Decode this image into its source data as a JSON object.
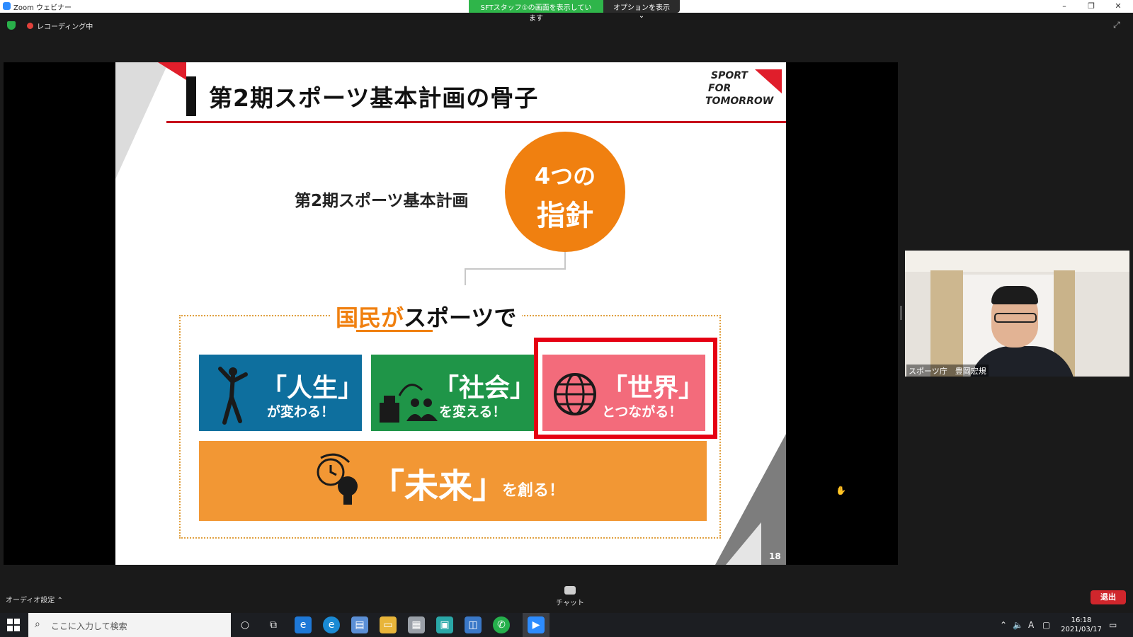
{
  "window": {
    "title": "Zoom ウェビナー",
    "share_banner": "SFTスタッフ①の画面を表示しています",
    "options_label": "オプションを表示 ⌄",
    "minimize": "–",
    "restore": "❐",
    "close": "✕"
  },
  "recording": {
    "label": "レコーディング中"
  },
  "slide": {
    "title": "第2期スポーツ基本計画の骨子",
    "logo_lines": [
      "SPORT",
      "FOR",
      "TOMORROW"
    ],
    "plan_label": "第2期スポーツ基本計画",
    "circle_line1": "4つの",
    "circle_line2": "指針",
    "nation_orange": "国民が",
    "nation_rest": "スポーツで",
    "cards": [
      {
        "big": "「人生」",
        "small": "が変わる！"
      },
      {
        "big": "「社会」",
        "small": "を変える！"
      },
      {
        "big": "「世界」",
        "small": "とつながる！"
      }
    ],
    "future_big": "「未来」",
    "future_small": "を創る！",
    "page_number": "18"
  },
  "participant": {
    "name": "スポーツ庁　豊岡宏規"
  },
  "toolbar": {
    "audio_label": "オーディオ設定 ⌃",
    "chat_label": "チャット",
    "leave_label": "退出"
  },
  "taskbar": {
    "search_placeholder": "ここに入力して検索",
    "time": "16:18",
    "date": "2021/03/17"
  },
  "colors": {
    "accent_orange": "#f08010",
    "life_blue": "#0e6f9e",
    "society_green": "#1f9548",
    "world_pink": "#f36b7b",
    "highlight_red": "#e50012",
    "leave_red": "#d0262c"
  }
}
